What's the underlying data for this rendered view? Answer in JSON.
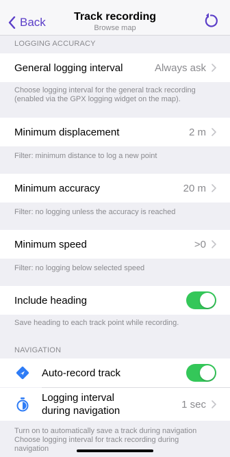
{
  "navbar": {
    "back_label": "Back",
    "title": "Track recording",
    "subtitle": "Browse map"
  },
  "logging_accuracy": {
    "header": "LOGGING ACCURACY",
    "general_interval": {
      "label": "General logging interval",
      "value": "Always ask"
    },
    "general_interval_note": "Choose logging interval for the general track recording (enabled via the GPX logging widget on the map).",
    "min_displacement": {
      "label": "Minimum displacement",
      "value": "2 m"
    },
    "min_displacement_note": "Filter: minimum distance to log a new point",
    "min_accuracy": {
      "label": "Minimum accuracy",
      "value": "20 m"
    },
    "min_accuracy_note": "Filter: no logging unless the accuracy is reached",
    "min_speed": {
      "label": "Minimum speed",
      "value": ">0"
    },
    "min_speed_note": "Filter: no logging below selected speed",
    "include_heading": {
      "label": "Include heading",
      "on": true
    },
    "include_heading_note": "Save heading to each track point while recording."
  },
  "navigation": {
    "header": "NAVIGATION",
    "auto_record": {
      "label": "Auto-record track",
      "on": true,
      "icon": "navigation-arrow-icon"
    },
    "logging_interval": {
      "label_line1": "Logging interval",
      "label_line2": "during navigation",
      "value": "1 sec",
      "icon": "timer-icon"
    },
    "note_line1": "Turn on to automatically save a track during navigation",
    "note_line2": "Choose logging interval for track recording during",
    "note_line3": "navigation"
  },
  "colors": {
    "accent": "#5b3ec8",
    "toggle_on": "#34c759",
    "nav_icon": "#2e7cf6"
  }
}
